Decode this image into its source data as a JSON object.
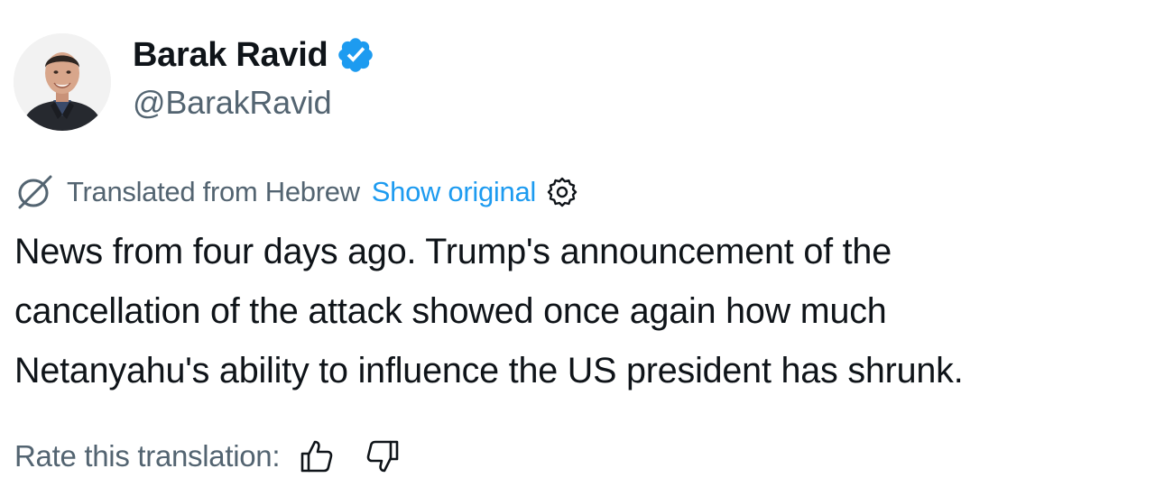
{
  "tweet": {
    "author": {
      "display_name": "Barak Ravid",
      "handle": "@BarakRavid",
      "verified": true,
      "avatar_icon": "profile-photo",
      "verified_icon": "verified-badge-icon"
    },
    "translation": {
      "icon": "translate-icon",
      "translated_from": "Translated from Hebrew",
      "show_original": "Show original",
      "settings_icon": "gear-icon"
    },
    "text": "News from four days ago. Trump's announcement of the\ncancellation of the attack showed once again how much\nNetanyahu's ability to influence the US president has shrunk.",
    "rating": {
      "label": "Rate this translation:",
      "up_icon": "thumbs-up-icon",
      "down_icon": "thumbs-down-icon"
    }
  },
  "colors": {
    "text_primary": "#0f1419",
    "text_secondary": "#536471",
    "link": "#1d9bf0",
    "verified": "#1d9bf0",
    "background": "#ffffff"
  }
}
